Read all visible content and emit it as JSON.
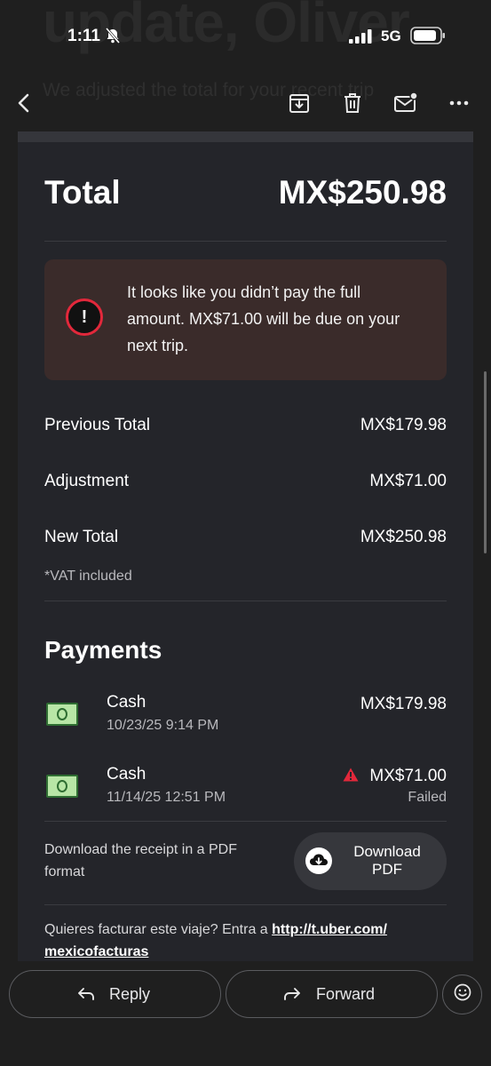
{
  "background_header": {
    "title": "update, Oliver",
    "subtitle": "We adjusted the total for your recent trip"
  },
  "status_bar": {
    "time": "1:11",
    "network": "5G"
  },
  "toolbar": {
    "icons": [
      "back-arrow-icon",
      "archive-icon",
      "trash-icon",
      "mark-unread-icon",
      "more-icon"
    ]
  },
  "receipt": {
    "total_label": "Total",
    "total_value": "MX$250.98",
    "alert": {
      "text": "It looks like you didn’t pay the full amount. MX$71.00 will be due on your next trip.",
      "icon_glyph": "!"
    },
    "breakdown": [
      {
        "label": "Previous Total",
        "value": "MX$179.98"
      },
      {
        "label": "Adjustment",
        "value": "MX$71.00"
      },
      {
        "label": "New Total",
        "value": "MX$250.98"
      }
    ],
    "vat_note": "*VAT included",
    "payments_title": "Payments",
    "payments": [
      {
        "method": "Cash",
        "datetime": "10/23/25 9:14 PM",
        "amount": "MX$179.98",
        "status": ""
      },
      {
        "method": "Cash",
        "datetime": "11/14/25 12:51 PM",
        "amount": "MX$71.00",
        "status": "Failed"
      }
    ],
    "download": {
      "text": "Download the receipt in a PDF format",
      "button_label": "Download PDF"
    },
    "factura": {
      "text": "Quieres facturar este viaje? Entra a",
      "link": "http://t.uber.com/ mexicofacturas"
    }
  },
  "bottom_bar": {
    "reply_label": "Reply",
    "forward_label": "Forward"
  },
  "colors": {
    "background": "#1f1f1f",
    "card": "#24252a",
    "alert_bg": "#3a2b2a",
    "alert_accent": "#e2283b",
    "cash_green": "#b8e6a6"
  }
}
